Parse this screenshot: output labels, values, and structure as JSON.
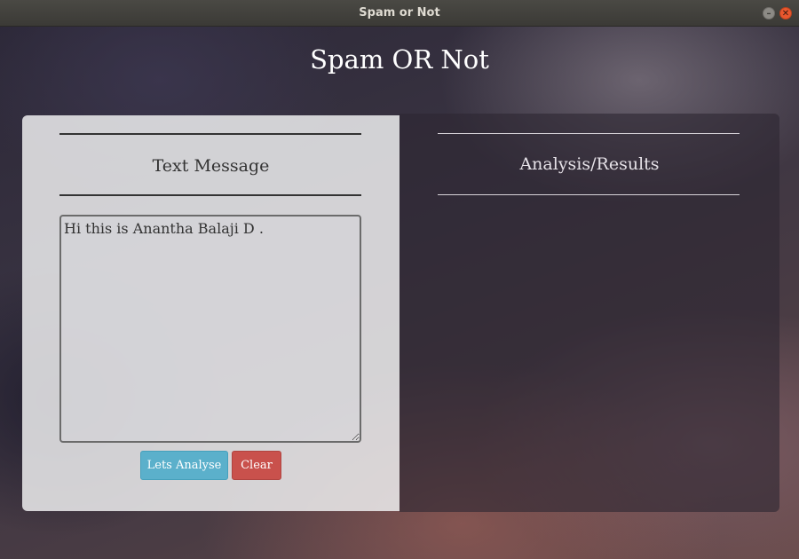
{
  "window": {
    "title": "Spam or Not",
    "minimize_icon": "minimize-icon",
    "close_icon": "close-icon",
    "minimize_glyph": "–",
    "close_glyph": "✕"
  },
  "app": {
    "title": "Spam OR Not"
  },
  "input_panel": {
    "heading": "Text Message",
    "message_value": "Hi this is Anantha Balaji D .",
    "analyse_label": "Lets Analyse",
    "clear_label": "Clear",
    "analyse_color": "#5bb0cb",
    "clear_color": "#c9514c"
  },
  "results_panel": {
    "heading": "Analysis/Results"
  }
}
